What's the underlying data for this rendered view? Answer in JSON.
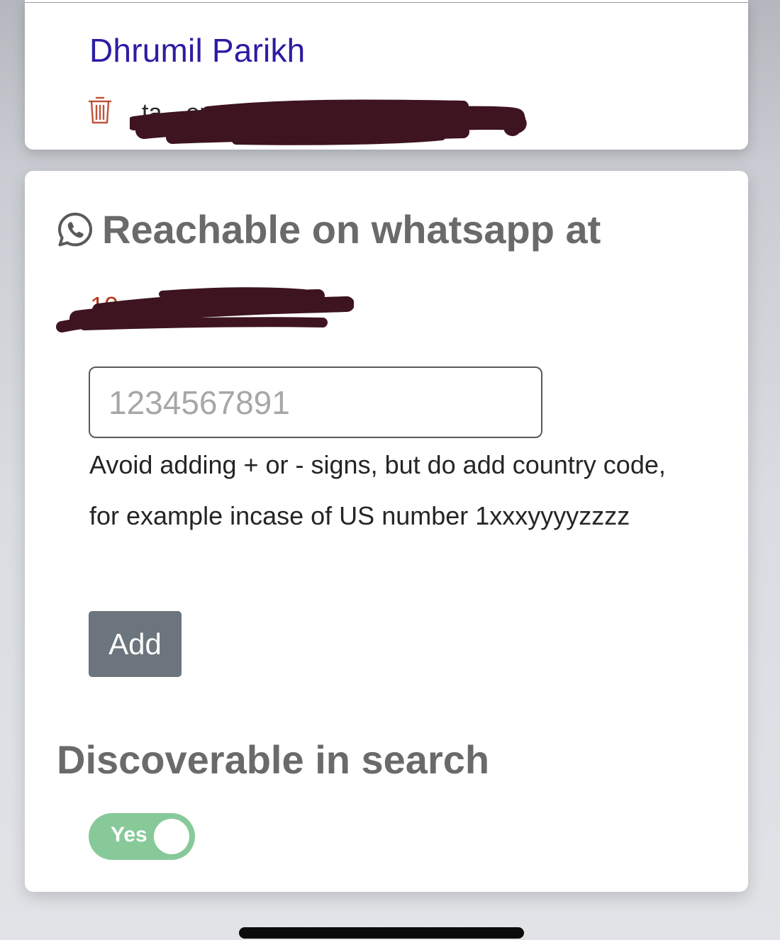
{
  "contact": {
    "name": "Dhrumil Parikh",
    "email_visible": "ta…om",
    "delete_icon": "trash-icon"
  },
  "whatsapp": {
    "icon": "whatsapp-icon",
    "heading": "Reachable on whatsapp at",
    "phone_visible": "10…",
    "input_placeholder": "1234567891",
    "input_value": "",
    "helper_text": "Avoid adding + or - signs, but do add country code, for example incase of US number 1xxxyyyyzzzz",
    "add_label": "Add"
  },
  "discoverable": {
    "heading": "Discoverable in search",
    "toggle_label": "Yes",
    "toggle_on": true
  },
  "colors": {
    "name_link": "#2c1ca3",
    "delete_icon": "#c0533a",
    "button_bg": "#6c757d",
    "toggle_bg": "#88c999",
    "redaction": "#3d1420"
  }
}
